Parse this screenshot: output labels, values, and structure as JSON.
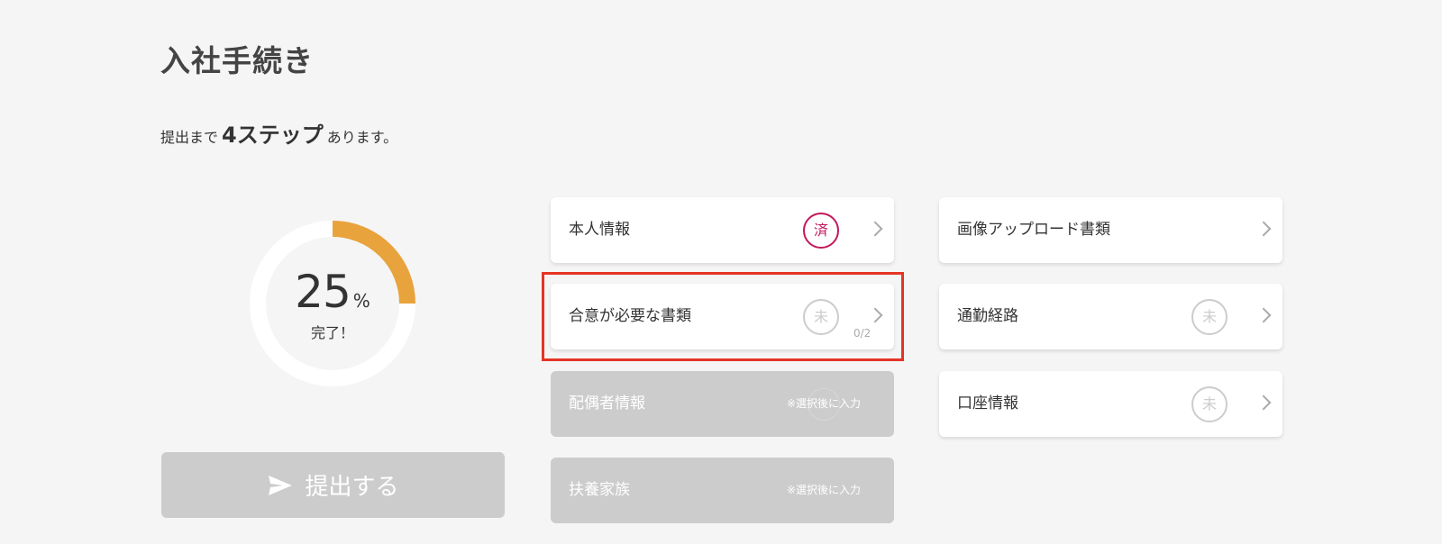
{
  "page": {
    "title": "入社手続き",
    "steps_prefix": "提出まで",
    "steps_count": "4ステップ",
    "steps_suffix": "あります。"
  },
  "progress": {
    "value": "25",
    "unit": "%",
    "label": "完了！",
    "fraction": 0.25,
    "accent_color": "#e8a33d",
    "track_color": "#ffffff"
  },
  "submit": {
    "label": "提出する",
    "icon": "send-icon",
    "enabled": false
  },
  "cards": {
    "personal_info": {
      "label": "本人情報",
      "status": "済"
    },
    "consent_documents": {
      "label": "合意が必要な書類",
      "status": "未",
      "count": "0/2"
    },
    "spouse_info": {
      "label": "配偶者情報",
      "note": "※選択後に入力"
    },
    "dependents": {
      "label": "扶養家族",
      "note": "※選択後に入力"
    },
    "image_upload": {
      "label": "画像アップロード書類"
    },
    "commute_route": {
      "label": "通勤経路",
      "status": "未"
    },
    "bank_account": {
      "label": "口座情報",
      "status": "未"
    }
  },
  "colors": {
    "done": "#c2185b",
    "pending": "#cccccc",
    "highlight": "#e53424",
    "disabled_bg": "#cccccc"
  }
}
